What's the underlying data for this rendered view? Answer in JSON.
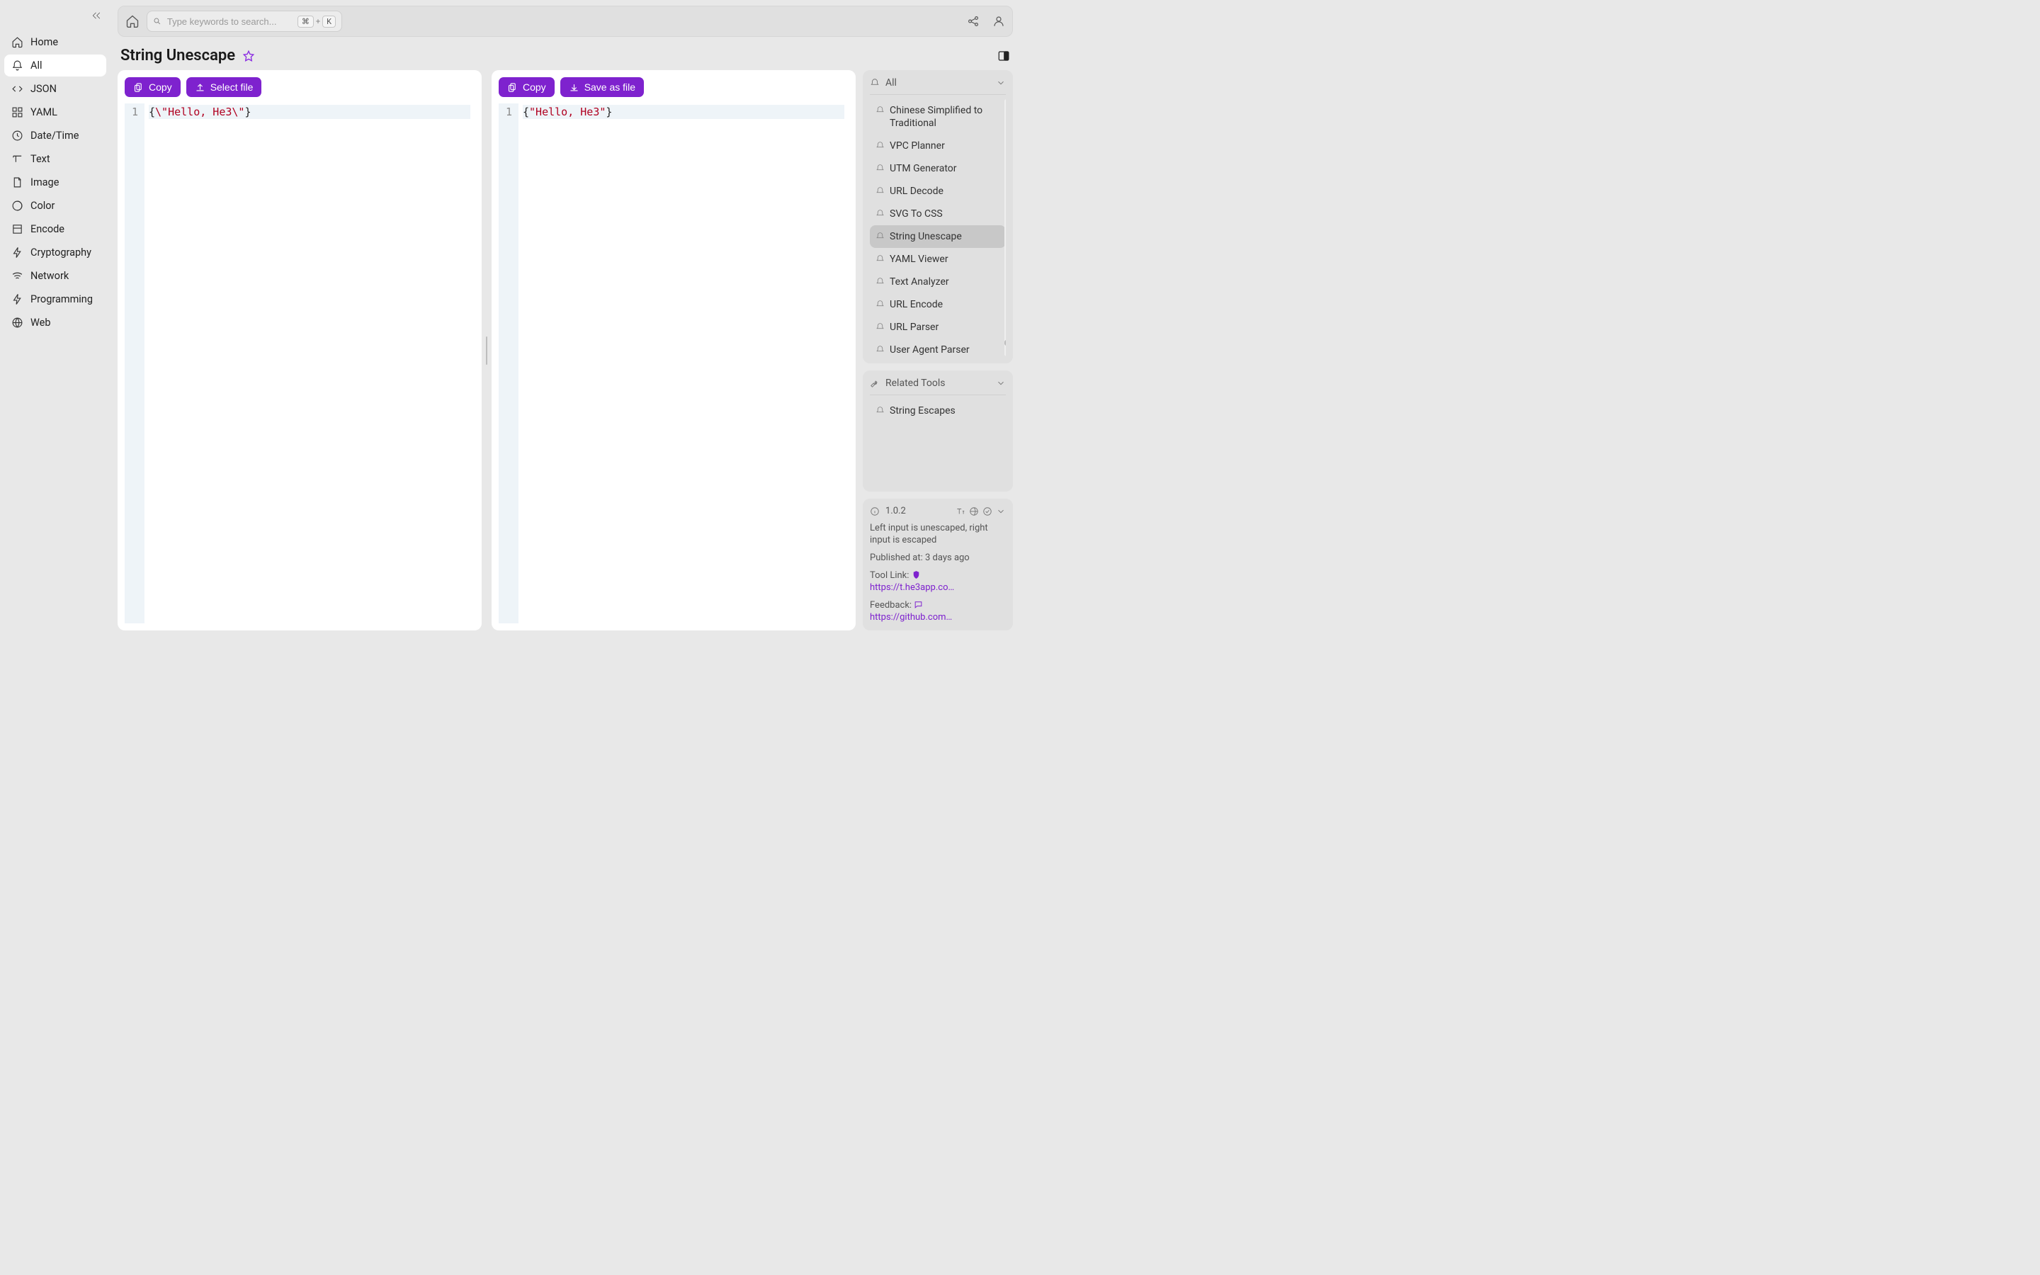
{
  "sidebar": {
    "items": [
      {
        "label": "Home",
        "icon": "home-icon"
      },
      {
        "label": "All",
        "icon": "bell-icon",
        "active": true
      },
      {
        "label": "JSON",
        "icon": "code-icon"
      },
      {
        "label": "YAML",
        "icon": "grid-icon"
      },
      {
        "label": "Date/Time",
        "icon": "clock-icon"
      },
      {
        "label": "Text",
        "icon": "type-icon"
      },
      {
        "label": "Image",
        "icon": "file-icon"
      },
      {
        "label": "Color",
        "icon": "palette-icon"
      },
      {
        "label": "Encode",
        "icon": "box-icon"
      },
      {
        "label": "Cryptography",
        "icon": "bolt-icon"
      },
      {
        "label": "Network",
        "icon": "wifi-icon"
      },
      {
        "label": "Programming",
        "icon": "bolt-icon"
      },
      {
        "label": "Web",
        "icon": "globe-icon"
      }
    ]
  },
  "topbar": {
    "search_placeholder": "Type keywords to search...",
    "kbd_cmd": "⌘",
    "kbd_plus": "+",
    "kbd_k": "K"
  },
  "page": {
    "title": "String Unescape"
  },
  "editor_left": {
    "copy": "Copy",
    "select_file": "Select file",
    "line_no": "1",
    "code_pre": "{",
    "code_str": "\\\"Hello, He3\\\"",
    "code_post": "}"
  },
  "editor_right": {
    "copy": "Copy",
    "save_file": "Save as file",
    "line_no": "1",
    "code_pre": "{",
    "code_str": "\"Hello, He3\"",
    "code_post": "}"
  },
  "all_panel": {
    "title": "All",
    "items": [
      {
        "label": "Chinese Simplified to Traditional"
      },
      {
        "label": "VPC Planner"
      },
      {
        "label": "UTM Generator"
      },
      {
        "label": "URL Decode"
      },
      {
        "label": "SVG To CSS"
      },
      {
        "label": "String Unescape",
        "active": true
      },
      {
        "label": "YAML Viewer"
      },
      {
        "label": "Text Analyzer"
      },
      {
        "label": "URL Encode"
      },
      {
        "label": "URL Parser"
      },
      {
        "label": "User Agent Parser"
      }
    ]
  },
  "related_panel": {
    "title": "Related Tools",
    "items": [
      {
        "label": "String Escapes"
      }
    ]
  },
  "info": {
    "version": "1.0.2",
    "desc": "Left input is unescaped, right input is escaped",
    "published_label": "Published at: ",
    "published_value": "3 days ago",
    "tool_link_label": "Tool Link: ",
    "tool_link_value": "https://t.he3app.co…",
    "feedback_label": "Feedback: ",
    "feedback_value": "https://github.com/…"
  }
}
